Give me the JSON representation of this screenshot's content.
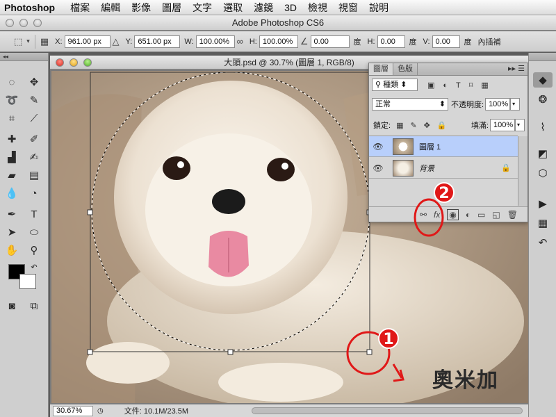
{
  "menubar": {
    "app": "Photoshop",
    "items": [
      "檔案",
      "編輯",
      "影像",
      "圖層",
      "文字",
      "選取",
      "濾鏡",
      "3D",
      "檢視",
      "視窗",
      "說明"
    ]
  },
  "window": {
    "title": "Adobe Photoshop CS6"
  },
  "options": {
    "x_label": "X:",
    "x_value": "961.00 px",
    "y_label": "Y:",
    "y_value": "651.00 px",
    "w_label": "W:",
    "w_value": "100.00%",
    "h_label": "H:",
    "h_value": "100.00%",
    "angle_value": "0.00",
    "angle_unit": "度",
    "hskew_label": "H:",
    "hskew_value": "0.00",
    "hskew_unit": "度",
    "vskew_label": "V:",
    "vskew_value": "0.00",
    "vskew_unit": "度",
    "interp": "內插補"
  },
  "document": {
    "title": "大頭.psd @ 30.7% (圖層 1, RGB/8)",
    "zoom": "30.67%",
    "doc_info": "文件: 10.1M/23.5M"
  },
  "layers_panel": {
    "tabs": [
      "圖層",
      "色版"
    ],
    "filter_kind": "種類",
    "blend_mode": "正常",
    "opacity_label": "不透明度:",
    "opacity_value": "100%",
    "lock_label": "鎖定:",
    "fill_label": "填滿:",
    "fill_value": "100%",
    "layers": [
      {
        "name": "圖層 1",
        "selected": true
      },
      {
        "name": "背景",
        "selected": false,
        "locked": true
      }
    ],
    "bottom_icons": [
      "link-icon",
      "fx-icon",
      "mask-icon",
      "adjustment-icon",
      "folder-icon",
      "new-layer-icon",
      "trash-icon"
    ]
  },
  "annotations": {
    "badge1": "1",
    "badge2": "2"
  },
  "watermark": {
    "text": "奧米加"
  },
  "colors": {
    "accent": "#b8cffb",
    "annotation_red": "#e01818"
  }
}
